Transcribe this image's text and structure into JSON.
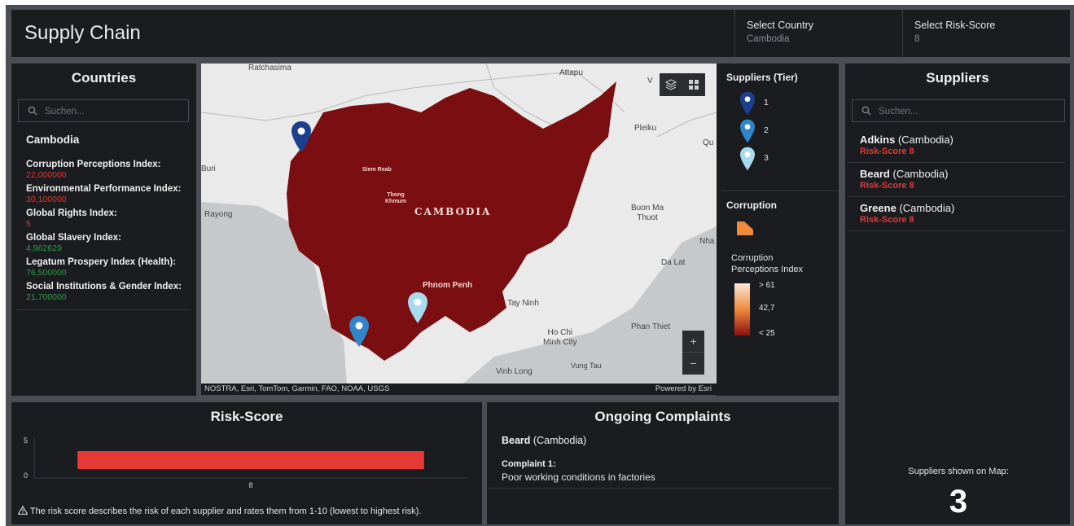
{
  "header": {
    "title": "Supply Chain",
    "country_select": {
      "label": "Select Country",
      "value": "Cambodia"
    },
    "risk_select": {
      "label": "Select Risk-Score",
      "value": "8"
    }
  },
  "countries": {
    "title": "Countries",
    "search_placeholder": "Suchen...",
    "selected": "Cambodia",
    "indices": [
      {
        "name": "Corruption Perceptions Index:",
        "value": "22,000000",
        "color": "#e53935"
      },
      {
        "name": "Environmental Performance Index:",
        "value": "30,100000",
        "color": "#e53935"
      },
      {
        "name": "Global Rights Index:",
        "value": "5",
        "color": "#e53935"
      },
      {
        "name": "Global Slavery Index:",
        "value": "4,962629",
        "color": "#2e9d4a"
      },
      {
        "name": "Legatum Prospery Index (Health):",
        "value": "76,500000",
        "color": "#2e9d4a"
      },
      {
        "name": "Social Institutions & Gender Index:",
        "value": "21,700000",
        "color": "#2e9d4a"
      }
    ]
  },
  "map": {
    "labels": {
      "ratchasima": "Ratchasima",
      "attapu": "Attapu",
      "v": "V",
      "pleiku": "Pleiku",
      "qu": "Qu",
      "buri": "Buri",
      "rayong": "Rayong",
      "buon_ma_thuot": "Buon Ma\nThuot",
      "nha": "Nha",
      "da_lat": "Da Lat",
      "tay_ninh": "Tay Ninh",
      "phan_thiet": "Phan Thiet",
      "ho_chi_minh": "Ho Chi\nMinh City",
      "vung_tau": "Vung Tau",
      "vinh_long": "Vinh Long",
      "cambodia": "CAMBODIA",
      "siem_reab": "Siem Reab",
      "tboung": "Tbong\nKhmum",
      "phnom_penh": "Phnom Penh"
    },
    "zoom_in": "+",
    "zoom_out": "−",
    "attribution": "NOSTRA, Esri, TomTom, Garmin, FAO, NOAA, USGS",
    "powered_by": "Powered by Esri"
  },
  "legend": {
    "suppliers_title": "Suppliers (Tier)",
    "tiers": [
      {
        "label": "1",
        "color": "#1d3f8f"
      },
      {
        "label": "2",
        "color": "#2f86c9"
      },
      {
        "label": "3",
        "color": "#a7dcef"
      }
    ],
    "corruption_title": "Corruption",
    "cpi_title": "Corruption\nPerceptions Index",
    "ramp": [
      {
        "label": "> 61",
        "color": "#fde8d7"
      },
      {
        "label": "42,7",
        "color": "#ee8a3c"
      },
      {
        "label": "< 25",
        "color": "#8c1010"
      }
    ]
  },
  "suppliers": {
    "title": "Suppliers",
    "search_placeholder": "Suchen...",
    "items": [
      {
        "name": "Adkins",
        "country": "(Cambodia)",
        "risk": "Risk-Score 8"
      },
      {
        "name": "Beard",
        "country": "(Cambodia)",
        "risk": "Risk-Score 8"
      },
      {
        "name": "Greene",
        "country": "(Cambodia)",
        "risk": "Risk-Score 8"
      }
    ],
    "count_label": "Suppliers shown on Map:",
    "count": "3"
  },
  "risk_score": {
    "title": "Risk-Score",
    "note": "The risk score describes the risk of each supplier and rates them from 1-10 (lowest to highest risk)."
  },
  "chart_data": {
    "type": "bar",
    "orientation": "horizontal",
    "categories": [
      "8"
    ],
    "values": [
      8
    ],
    "y_ticks": [
      "5",
      "0"
    ],
    "color": "#e53935"
  },
  "complaints": {
    "title": "Ongoing Complaints",
    "supplier_name": "Beard",
    "supplier_country": "(Cambodia)",
    "complaint_title": "Complaint 1:",
    "complaint_text": "Poor working conditions in factories"
  }
}
